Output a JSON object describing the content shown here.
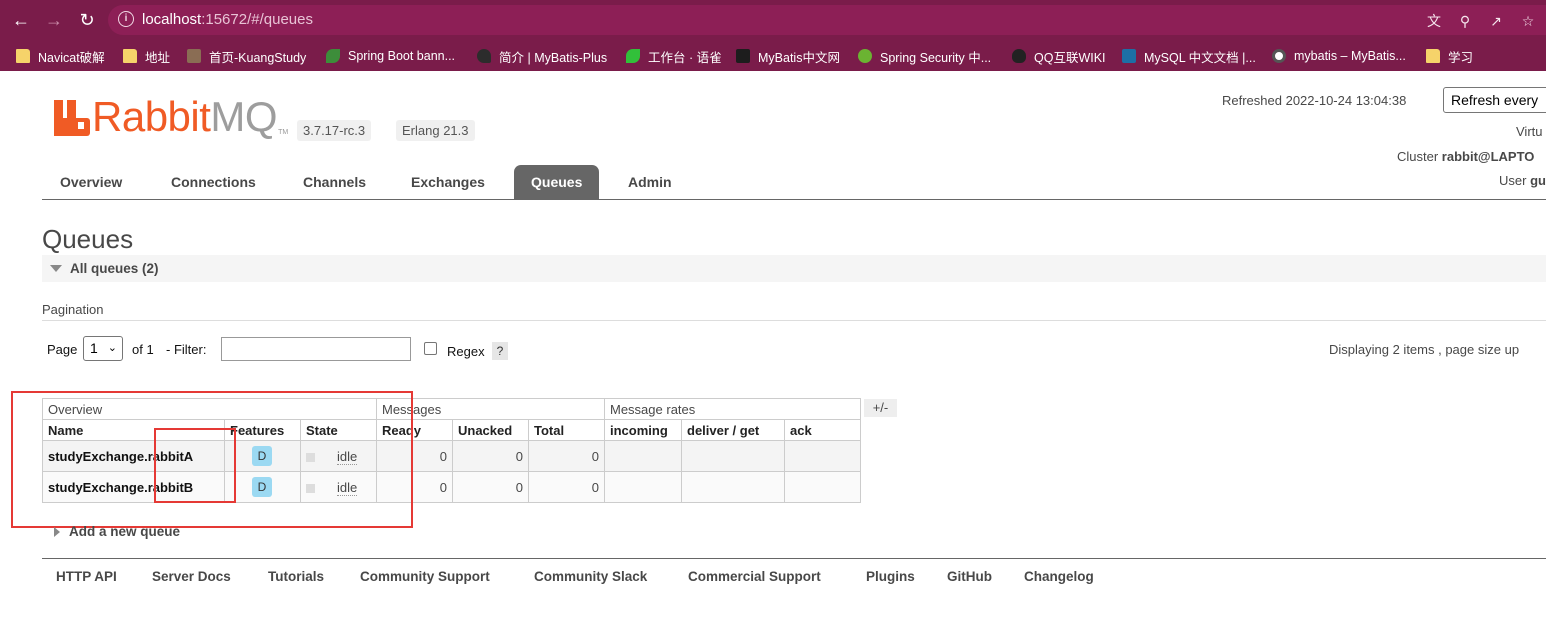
{
  "browser": {
    "url_host": "localhost",
    "url_rest": ":15672/#/queues",
    "bookmarks": [
      {
        "label": "Navicat破解",
        "icon": "folder-icon"
      },
      {
        "label": "地址",
        "icon": "folder-icon"
      },
      {
        "label": "首页-KuangStudy",
        "icon": "avatar-icon"
      },
      {
        "label": "Spring Boot bann...",
        "icon": "leaf-icon"
      },
      {
        "label": "简介 | MyBatis-Plus",
        "icon": "bird-icon"
      },
      {
        "label": "工作台 · 语雀",
        "icon": "yuque-icon"
      },
      {
        "label": "MyBatis中文网",
        "icon": "mybatis-icon"
      },
      {
        "label": "Spring Security 中...",
        "icon": "spring-security-icon"
      },
      {
        "label": "QQ互联WIKI",
        "icon": "qq-icon"
      },
      {
        "label": "MySQL 中文文档 |...",
        "icon": "mysql-icon"
      },
      {
        "label": "mybatis – MyBatis...",
        "icon": "globe-icon"
      },
      {
        "label": "学习",
        "icon": "folder-icon"
      }
    ]
  },
  "app": {
    "logo_rabbit": "Rabbit",
    "logo_mq": "MQ",
    "logo_tm": "TM",
    "version": "3.7.17-rc.3",
    "erlang": "Erlang 21.3",
    "refreshed": "Refreshed 2022-10-24 13:04:38",
    "refresh_select": "Refresh every",
    "virtual_host_label": "Virtu",
    "cluster_label": "Cluster ",
    "cluster_value": "rabbit@LAPTO",
    "user_label": "User ",
    "user_value": "gu"
  },
  "tabs": [
    "Overview",
    "Connections",
    "Channels",
    "Exchanges",
    "Queues",
    "Admin"
  ],
  "active_tab": "Queues",
  "page_title": "Queues",
  "section_title": "All queues (2)",
  "pagination": {
    "title": "Pagination",
    "page_label": "Page",
    "page_value": "1",
    "of_label": "of 1",
    "filter_label": "- Filter:",
    "regex_label": "Regex",
    "help": "?",
    "displaying": "Displaying 2 items , page size up"
  },
  "table": {
    "groups": [
      "Overview",
      "Messages",
      "Message rates"
    ],
    "plus_minus": "+/-",
    "columns": [
      "Name",
      "Features",
      "State",
      "Ready",
      "Unacked",
      "Total",
      "incoming",
      "deliver / get",
      "ack"
    ],
    "rows": [
      {
        "name": "studyExchange.rabbitA",
        "feature": "D",
        "state": "idle",
        "ready": "0",
        "unacked": "0",
        "total": "0",
        "incoming": "",
        "deliver_get": "",
        "ack": ""
      },
      {
        "name": "studyExchange.rabbitB",
        "feature": "D",
        "state": "idle",
        "ready": "0",
        "unacked": "0",
        "total": "0",
        "incoming": "",
        "deliver_get": "",
        "ack": ""
      }
    ]
  },
  "add_queue": "Add a new queue",
  "footer": [
    "HTTP API",
    "Server Docs",
    "Tutorials",
    "Community Support",
    "Community Slack",
    "Commercial Support",
    "Plugins",
    "GitHub",
    "Changelog"
  ],
  "colors": {
    "browser_chrome": "#7a1c4a",
    "brand_orange": "#f05b25",
    "active_tab": "#666666",
    "annotation_red": "#e53935",
    "feature_badge": "#9bd9f2"
  }
}
